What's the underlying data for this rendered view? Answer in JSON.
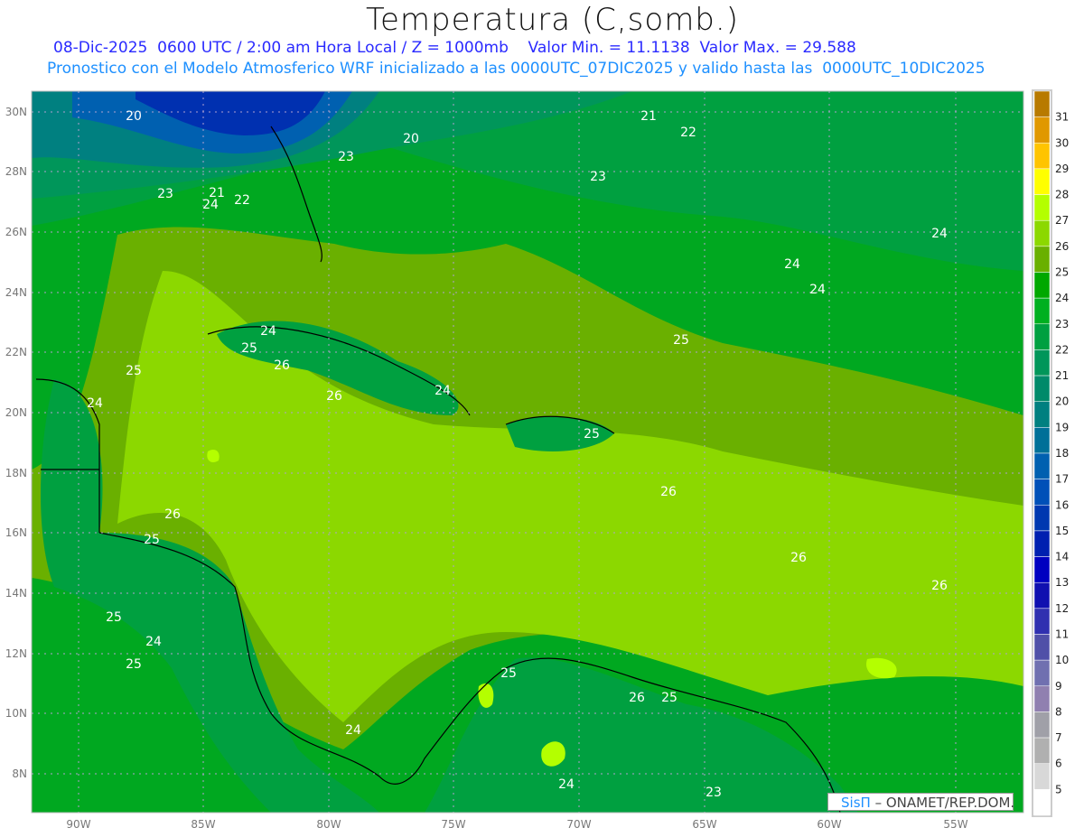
{
  "header": {
    "title": "Temperatura (C,somb.)",
    "subtitle": "08-Dic-2025  0600 UTC / 2:00 am Hora Local / Z = 1000mb    Valor Min. = 11.1138  Valor Max. = 29.588",
    "description": "Pronostico con el Modelo Atmosferico WRF inicializado a las 0000UTC_07DIC2025 y valido hasta las  0000UTC_10DIC2025"
  },
  "axes": {
    "lon_labels": [
      "90W",
      "85W",
      "80W",
      "75W",
      "70W",
      "65W",
      "60W",
      "55W"
    ],
    "lat_labels": [
      "30N",
      "28N",
      "26N",
      "24N",
      "22N",
      "20N",
      "18N",
      "16N",
      "14N",
      "12N",
      "10N",
      "8N"
    ]
  },
  "colorbar": {
    "labels": [
      "31",
      "30",
      "29",
      "28",
      "27",
      "26",
      "25",
      "24",
      "23",
      "22",
      "21",
      "20",
      "19",
      "18",
      "17",
      "16",
      "15",
      "14",
      "13",
      "12",
      "11",
      "10",
      "9",
      "8",
      "7",
      "6",
      "5"
    ],
    "colors": [
      "#b87a00",
      "#e09800",
      "#ffc400",
      "#ffff00",
      "#b4ff00",
      "#8cd800",
      "#6ab000",
      "#00a800",
      "#00b020",
      "#00a040",
      "#00965a",
      "#008a6a",
      "#008080",
      "#007098",
      "#0060b0",
      "#0050b8",
      "#0038b0",
      "#0020b0",
      "#0000c0",
      "#1010b0",
      "#3030b0",
      "#5050a8",
      "#7070b0",
      "#9080b0",
      "#a0a0a8",
      "#b0b0b0",
      "#d8d8d8",
      "#ffffff"
    ]
  },
  "contour_labels": [
    "20",
    "21",
    "20",
    "22",
    "23",
    "23",
    "23",
    "21",
    "22",
    "24",
    "24",
    "24",
    "24",
    "24",
    "25",
    "25",
    "26",
    "25",
    "26",
    "24",
    "24",
    "25",
    "26",
    "26",
    "25",
    "26",
    "26",
    "25",
    "24",
    "25",
    "25",
    "26",
    "25",
    "24",
    "24",
    "23"
  ],
  "credit": {
    "logo": "SisΠ",
    "text": " – ONAMET/REP.DOM."
  }
}
